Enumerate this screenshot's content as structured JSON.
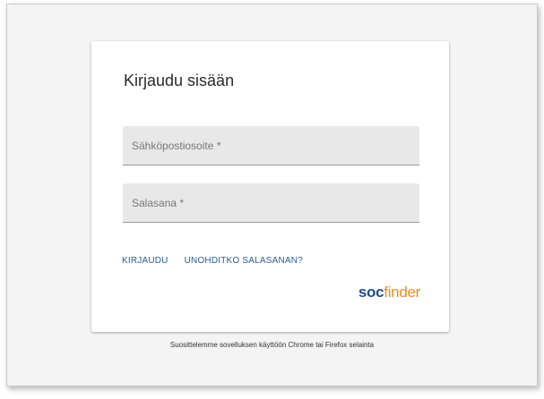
{
  "login": {
    "title": "Kirjaudu sisään",
    "email_label": "Sähköpostiosoite *",
    "email_value": "",
    "password_label": "Salasana *",
    "password_value": "",
    "login_link": "KIRJAUDU",
    "forgot_link": "UNOHDITKO SALASANAN?"
  },
  "logo": {
    "part1": "soc",
    "part2": "finder",
    "color_primary": "#1d4f8c",
    "color_accent": "#f08a1c"
  },
  "footer": {
    "note": "Suosittelemme sovelluksen käyttöön Chrome tai Firefox selainta"
  }
}
